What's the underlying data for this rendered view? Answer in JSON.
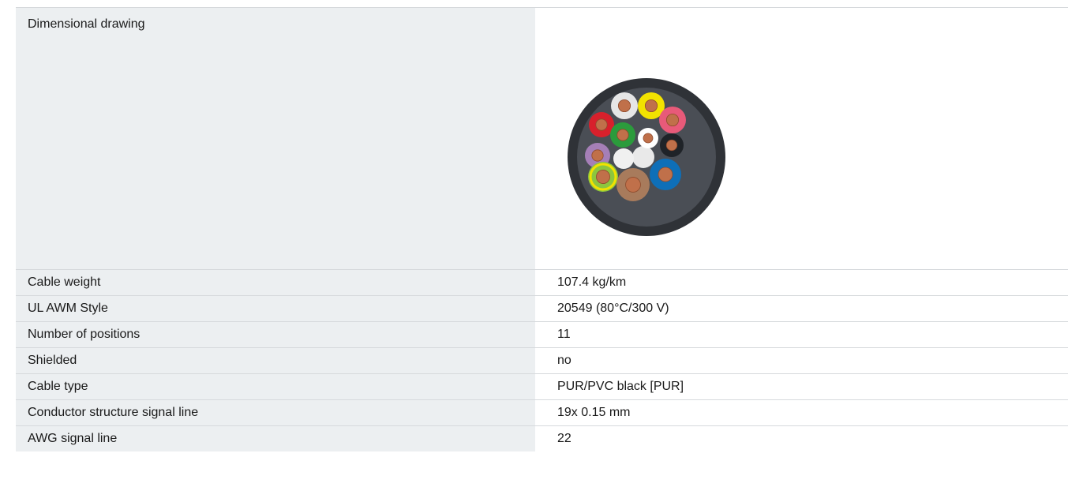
{
  "rows": [
    {
      "label": "Dimensional drawing",
      "type": "image",
      "image_name": "cable-cross-section-image"
    },
    {
      "label": "Cable weight",
      "value": "107.4 kg/km"
    },
    {
      "label": "UL AWM Style",
      "value": "20549 (80°C/300 V)"
    },
    {
      "label": "Number of positions",
      "value": "11"
    },
    {
      "label": "Shielded",
      "value": "no"
    },
    {
      "label": "Cable type",
      "value": "PUR/PVC black [PUR]"
    },
    {
      "label": "Conductor structure signal line",
      "value": "19x 0.15 mm"
    },
    {
      "label": "AWG signal line",
      "value": "22"
    }
  ],
  "cable_colors": {
    "jacket": "#2f3237",
    "filler": "#4a4e55",
    "copper": "#c0704a",
    "cores": [
      "#e6e6e6",
      "#f2e200",
      "#e85a79",
      "#d8202c",
      "#2b9b3c",
      "#ffffff",
      "#1f2328",
      "#a57fb7",
      "#f0f0f0",
      "#0e6fb8",
      "#8cc63f",
      "#a87b5c"
    ]
  }
}
